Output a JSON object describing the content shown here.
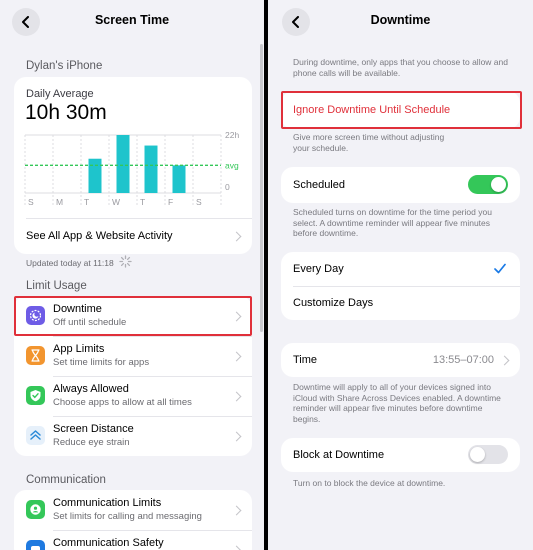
{
  "left": {
    "nav_title": "Screen Time",
    "device_name": "Dylan's iPhone",
    "daily_label": "Daily Average",
    "daily_value": "10h 30m",
    "see_all": "See All App & Website Activity",
    "updated": "Updated today at 11:18",
    "limit_usage_header": "Limit Usage",
    "items": [
      {
        "title": "Downtime",
        "subtitle": "Off until schedule",
        "icon": "downtime-icon",
        "color": "#6e5ce6"
      },
      {
        "title": "App Limits",
        "subtitle": "Set time limits for apps",
        "icon": "hourglass-icon",
        "color": "#f2952f"
      },
      {
        "title": "Always Allowed",
        "subtitle": "Choose apps to allow at all times",
        "icon": "checkmark-shield-icon",
        "color": "#34c759"
      },
      {
        "title": "Screen Distance",
        "subtitle": "Reduce eye strain",
        "icon": "screen-distance-icon",
        "color": "#e6f0fa"
      }
    ],
    "communication_header": "Communication",
    "comm_items": [
      {
        "title": "Communication Limits",
        "subtitle": "Set limits for calling and messaging",
        "icon": "person-bubble-icon",
        "color": "#34c759"
      },
      {
        "title": "Communication Safety",
        "subtitle": "",
        "icon": "communication-safety-icon",
        "color": "#1f7ae0"
      }
    ]
  },
  "chart_data": {
    "type": "bar",
    "categories": [
      "S",
      "M",
      "T",
      "W",
      "T",
      "F",
      "S"
    ],
    "values": [
      0,
      0,
      13,
      22,
      18,
      10.5,
      0
    ],
    "ylim": [
      0,
      22
    ],
    "ytick_labels": [
      "22h",
      "avg",
      "0"
    ],
    "avg": 10.5,
    "bar_color": "#1ec4cc",
    "avg_color": "#34c759"
  },
  "right": {
    "nav_title": "Downtime",
    "intro": "During downtime, only apps that you choose to allow and phone calls will be available.",
    "ignore_label": "Ignore Downtime Until Schedule",
    "ignore_note": "Give more screen time without adjusting your schedule.",
    "scheduled_label": "Scheduled",
    "scheduled_on": true,
    "scheduled_note": "Scheduled turns on downtime for the time period you select. A downtime reminder will appear five minutes before downtime.",
    "every_day": "Every Day",
    "customize_days": "Customize Days",
    "time_label": "Time",
    "time_value": "13:55–07:00",
    "time_note": "Downtime will apply to all of your devices signed into iCloud with Share Across Devices enabled. A downtime reminder will appear five minutes before downtime begins.",
    "block_label": "Block at Downtime",
    "block_on": false,
    "block_note": "Turn on to block the device at downtime."
  },
  "colors": {
    "accent_blue": "#1a7ae6",
    "red": "#e0303a",
    "toggle_on": "#34c759",
    "toggle_off": "#e3e3e8"
  }
}
